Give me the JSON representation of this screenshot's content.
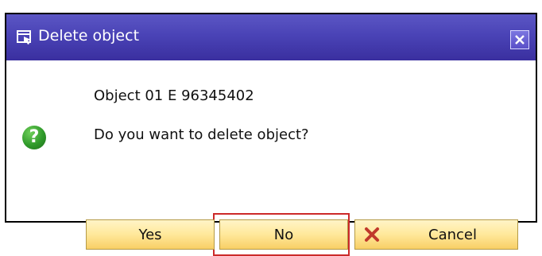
{
  "window": {
    "title": "Delete object",
    "title_icon": "window-pointer-icon",
    "close_icon": "close-icon"
  },
  "message": {
    "icon": "question-icon",
    "icon_glyph": "?",
    "line1": "Object 01 E 96345402",
    "line2": "Do you want to delete object?"
  },
  "buttons": {
    "yes": "Yes",
    "no": "No",
    "cancel": "Cancel",
    "cancel_icon": "cancel-x-icon",
    "focused": "No"
  },
  "colors": {
    "titlebar": "#4a43b6",
    "button_fill": "#ffe89a",
    "focus": "#cc2a2a",
    "question_icon": "#2f9a2a",
    "cancel_icon": "#c0392b"
  }
}
